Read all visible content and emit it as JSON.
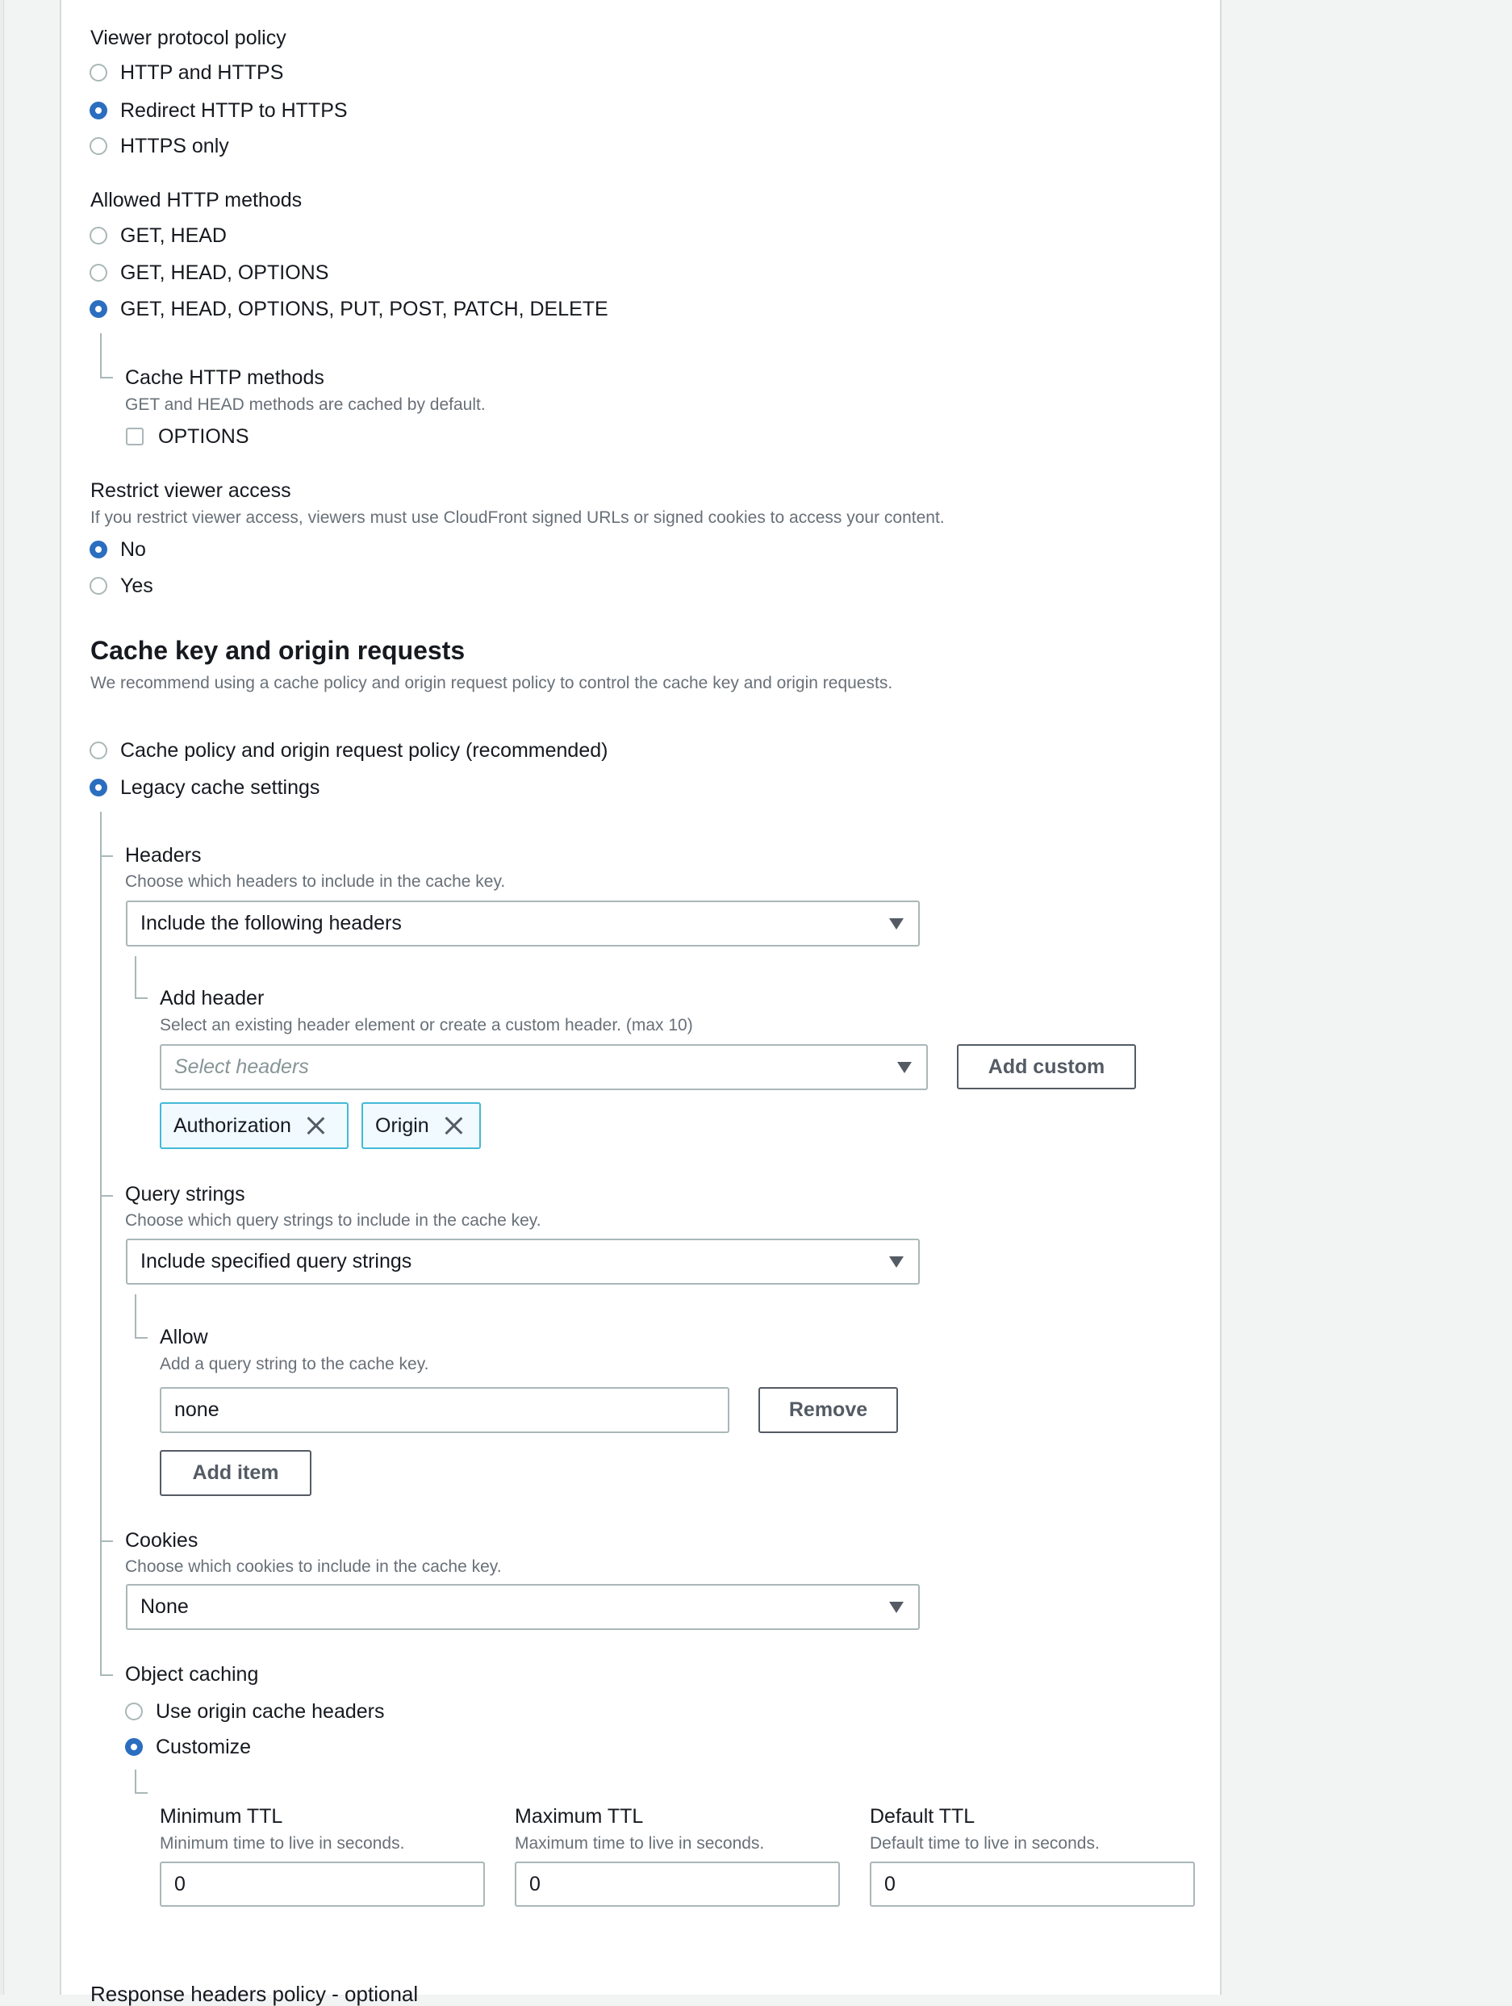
{
  "viewer_protocol": {
    "label": "Viewer protocol policy",
    "options": [
      {
        "label": "HTTP and HTTPS",
        "checked": false
      },
      {
        "label": "Redirect HTTP to HTTPS",
        "checked": true
      },
      {
        "label": "HTTPS only",
        "checked": false
      }
    ]
  },
  "allowed_methods": {
    "label": "Allowed HTTP methods",
    "options": [
      {
        "label": "GET, HEAD",
        "checked": false
      },
      {
        "label": "GET, HEAD, OPTIONS",
        "checked": false
      },
      {
        "label": "GET, HEAD, OPTIONS, PUT, POST, PATCH, DELETE",
        "checked": true
      }
    ],
    "cache_methods": {
      "label": "Cache HTTP methods",
      "description": "GET and HEAD methods are cached by default.",
      "checkbox_label": "OPTIONS",
      "checked": false
    }
  },
  "restrict_access": {
    "label": "Restrict viewer access",
    "description": "If you restrict viewer access, viewers must use CloudFront signed URLs or signed cookies to access your content.",
    "options": [
      {
        "label": "No",
        "checked": true
      },
      {
        "label": "Yes",
        "checked": false
      }
    ]
  },
  "cache_key": {
    "heading": "Cache key and origin requests",
    "description": "We recommend using a cache policy and origin request policy to control the cache key and origin requests.",
    "options": [
      {
        "label": "Cache policy and origin request policy (recommended)",
        "checked": false
      },
      {
        "label": "Legacy cache settings",
        "checked": true
      }
    ]
  },
  "headers": {
    "label": "Headers",
    "description": "Choose which headers to include in the cache key.",
    "selected": "Include the following headers",
    "add_header": {
      "label": "Add header",
      "description": "Select an existing header element or create a custom header. (max 10)",
      "placeholder": "Select headers",
      "add_custom_label": "Add custom",
      "tokens": [
        "Authorization",
        "Origin"
      ]
    }
  },
  "query_strings": {
    "label": "Query strings",
    "description": "Choose which query strings to include in the cache key.",
    "selected": "Include specified query strings",
    "allow": {
      "label": "Allow",
      "description": "Add a query string to the cache key.",
      "value": "none",
      "remove_label": "Remove",
      "add_item_label": "Add item"
    }
  },
  "cookies": {
    "label": "Cookies",
    "description": "Choose which cookies to include in the cache key.",
    "selected": "None"
  },
  "object_caching": {
    "label": "Object caching",
    "options": [
      {
        "label": "Use origin cache headers",
        "checked": false
      },
      {
        "label": "Customize",
        "checked": true
      }
    ],
    "ttl": [
      {
        "label": "Minimum TTL",
        "description": "Minimum time to live in seconds.",
        "value": "0"
      },
      {
        "label": "Maximum TTL",
        "description": "Maximum time to live in seconds.",
        "value": "0"
      },
      {
        "label": "Default TTL",
        "description": "Default time to live in seconds.",
        "value": "0"
      }
    ]
  },
  "next_section": {
    "heading": "Response headers policy - optional"
  },
  "colors": {
    "accent": "#2b6ec0",
    "token_border": "#44b9d6",
    "token_bg": "#f1faff",
    "page_bg": "#f2f3f3"
  }
}
